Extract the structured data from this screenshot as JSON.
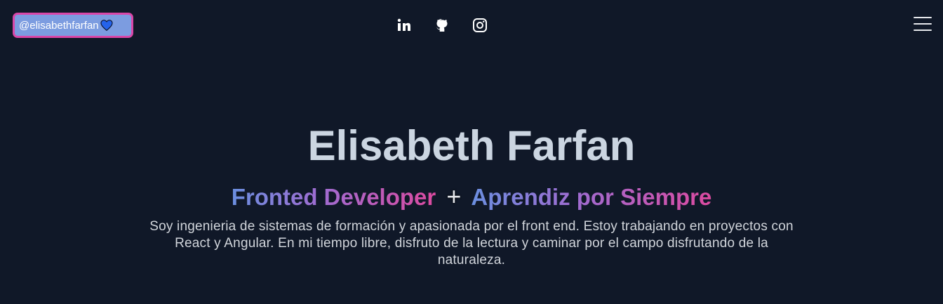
{
  "header": {
    "handle": "@elisabethfarfan",
    "handle_emoji_icon": "blue-heart-icon",
    "social_links": [
      {
        "name": "linkedin",
        "icon": "linkedin-icon"
      },
      {
        "name": "github",
        "icon": "github-icon"
      },
      {
        "name": "instagram",
        "icon": "instagram-icon"
      }
    ],
    "menu_icon": "hamburger-menu-icon"
  },
  "hero": {
    "name": "Elisabeth Farfan",
    "tagline_part1": "Fronted Developer",
    "tagline_separator": "+",
    "tagline_part2": "Aprendiz por Siempre",
    "bio": "Soy ingenieria de sistemas de formación y apasionada por el front end. Estoy trabajando en proyectos con React y Angular. En mi tiempo libre, disfruto de la lectura y caminar por el campo disfrutando de la naturaleza."
  },
  "colors": {
    "background": "#101828",
    "badge_bg": "#7c9ce0",
    "badge_border": "#d946a8",
    "gradient_start": "#6b8fe0",
    "gradient_end": "#dc4aa0"
  }
}
